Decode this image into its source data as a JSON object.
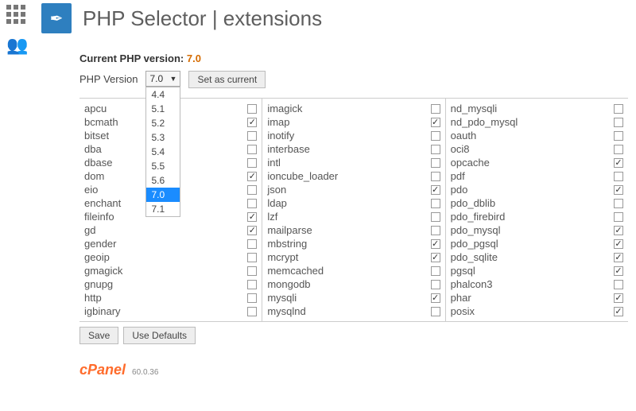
{
  "title": "PHP Selector | extensions",
  "current_label": "Current PHP version:",
  "current_value": "7.0",
  "version_label": "PHP Version",
  "selected_version": "7.0",
  "set_current_label": "Set as current",
  "version_options": [
    "4.4",
    "5.1",
    "5.2",
    "5.3",
    "5.4",
    "5.5",
    "5.6",
    "7.0",
    "7.1"
  ],
  "save_label": "Save",
  "defaults_label": "Use Defaults",
  "brand": "cPanel",
  "brand_version": "60.0.36",
  "columns": [
    [
      {
        "name": "apcu",
        "checked": false
      },
      {
        "name": "bcmath",
        "checked": true
      },
      {
        "name": "bitset",
        "checked": false
      },
      {
        "name": "dba",
        "checked": false
      },
      {
        "name": "dbase",
        "checked": false
      },
      {
        "name": "dom",
        "checked": true
      },
      {
        "name": "eio",
        "checked": false
      },
      {
        "name": "enchant",
        "checked": false
      },
      {
        "name": "fileinfo",
        "checked": true
      },
      {
        "name": "gd",
        "checked": true
      },
      {
        "name": "gender",
        "checked": false
      },
      {
        "name": "geoip",
        "checked": false
      },
      {
        "name": "gmagick",
        "checked": false
      },
      {
        "name": "gnupg",
        "checked": false
      },
      {
        "name": "http",
        "checked": false
      },
      {
        "name": "igbinary",
        "checked": false
      }
    ],
    [
      {
        "name": "imagick",
        "checked": false
      },
      {
        "name": "imap",
        "checked": true
      },
      {
        "name": "inotify",
        "checked": false
      },
      {
        "name": "interbase",
        "checked": false
      },
      {
        "name": "intl",
        "checked": false
      },
      {
        "name": "ioncube_loader",
        "checked": false
      },
      {
        "name": "json",
        "checked": true
      },
      {
        "name": "ldap",
        "checked": false
      },
      {
        "name": "lzf",
        "checked": false
      },
      {
        "name": "mailparse",
        "checked": false
      },
      {
        "name": "mbstring",
        "checked": true
      },
      {
        "name": "mcrypt",
        "checked": true
      },
      {
        "name": "memcached",
        "checked": false
      },
      {
        "name": "mongodb",
        "checked": false
      },
      {
        "name": "mysqli",
        "checked": true
      },
      {
        "name": "mysqlnd",
        "checked": false
      }
    ],
    [
      {
        "name": "nd_mysqli",
        "checked": false
      },
      {
        "name": "nd_pdo_mysql",
        "checked": false
      },
      {
        "name": "oauth",
        "checked": false
      },
      {
        "name": "oci8",
        "checked": false
      },
      {
        "name": "opcache",
        "checked": true
      },
      {
        "name": "pdf",
        "checked": false
      },
      {
        "name": "pdo",
        "checked": true
      },
      {
        "name": "pdo_dblib",
        "checked": false
      },
      {
        "name": "pdo_firebird",
        "checked": false
      },
      {
        "name": "pdo_mysql",
        "checked": true
      },
      {
        "name": "pdo_pgsql",
        "checked": true
      },
      {
        "name": "pdo_sqlite",
        "checked": true
      },
      {
        "name": "pgsql",
        "checked": true
      },
      {
        "name": "phalcon3",
        "checked": false
      },
      {
        "name": "phar",
        "checked": true
      },
      {
        "name": "posix",
        "checked": true
      }
    ]
  ]
}
